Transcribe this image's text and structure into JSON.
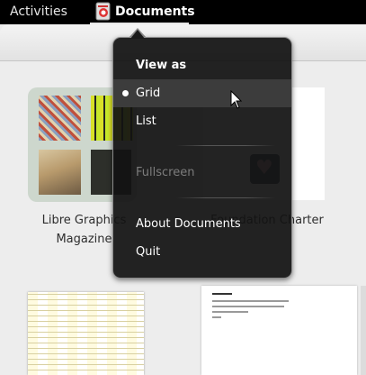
{
  "topbar": {
    "activities_label": "Activities",
    "app_menu_label": "Documents"
  },
  "documents": [
    {
      "title": "Libre Graphics Magazine"
    },
    {
      "title": "Foundation Charter"
    }
  ],
  "menu": {
    "heading": "View as",
    "grid_label": "Grid",
    "list_label": "List",
    "fullscreen_label": "Fullscreen",
    "about_label": "About Documents",
    "quit_label": "Quit",
    "selected_view": "Grid"
  },
  "colors": {
    "topbar_bg": "#000000",
    "menu_bg": "#121212",
    "menu_highlight": "#3c3c3c",
    "menu_disabled_text": "#7c7c7c"
  },
  "icons": [
    "documents-app-icon",
    "heart-icon",
    "mouse-pointer-icon",
    "radio-selected-icon"
  ]
}
